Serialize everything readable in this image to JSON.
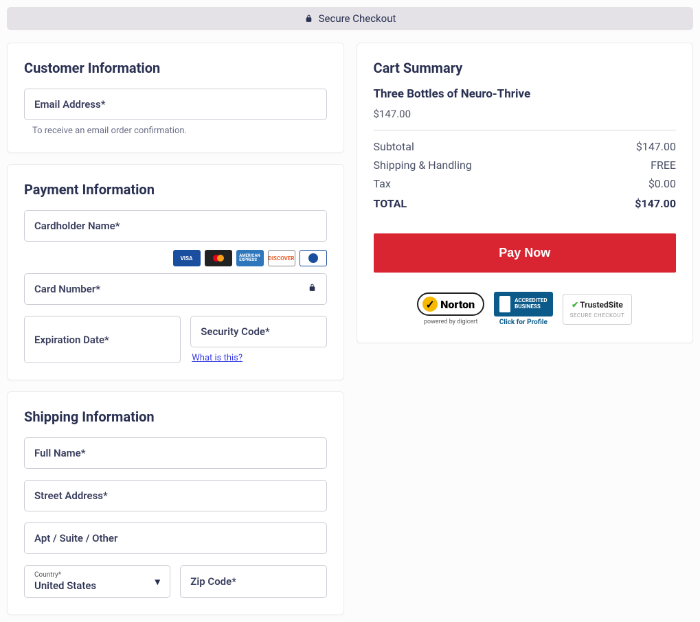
{
  "header": {
    "secure_text": "Secure Checkout"
  },
  "customer": {
    "title": "Customer Information",
    "email_placeholder": "Email Address*",
    "email_helper": "To receive an email order confirmation."
  },
  "payment": {
    "title": "Payment Information",
    "cardholder_placeholder": "Cardholder Name*",
    "cardnumber_placeholder": "Card Number*",
    "expiration_placeholder": "Expiration Date*",
    "cvv_placeholder": "Security Code*",
    "what_is_this": "What is this?"
  },
  "shipping": {
    "title": "Shipping Information",
    "fullname_placeholder": "Full Name*",
    "street_placeholder": "Street Address*",
    "apt_placeholder": "Apt / Suite / Other",
    "country_label": "Country*",
    "country_value": "United States",
    "zip_placeholder": "Zip Code*"
  },
  "cart": {
    "title": "Cart Summary",
    "product_name": "Three Bottles of Neuro-Thrive",
    "product_price": "$147.00",
    "lines": {
      "subtotal_label": "Subtotal",
      "subtotal_value": "$147.00",
      "shipping_label": "Shipping & Handling",
      "shipping_value": "FREE",
      "tax_label": "Tax",
      "tax_value": "$0.00",
      "total_label": "TOTAL",
      "total_value": "$147.00"
    },
    "pay_button": "Pay Now"
  },
  "badges": {
    "norton_name": "Norton",
    "norton_sub": "powered by digicert",
    "bbb_accredited": "ACCREDITED",
    "bbb_business": "BUSINESS",
    "bbb_click": "Click for Profile",
    "trustedsite_title": "TrustedSite",
    "trustedsite_sub": "SECURE CHECKOUT"
  }
}
